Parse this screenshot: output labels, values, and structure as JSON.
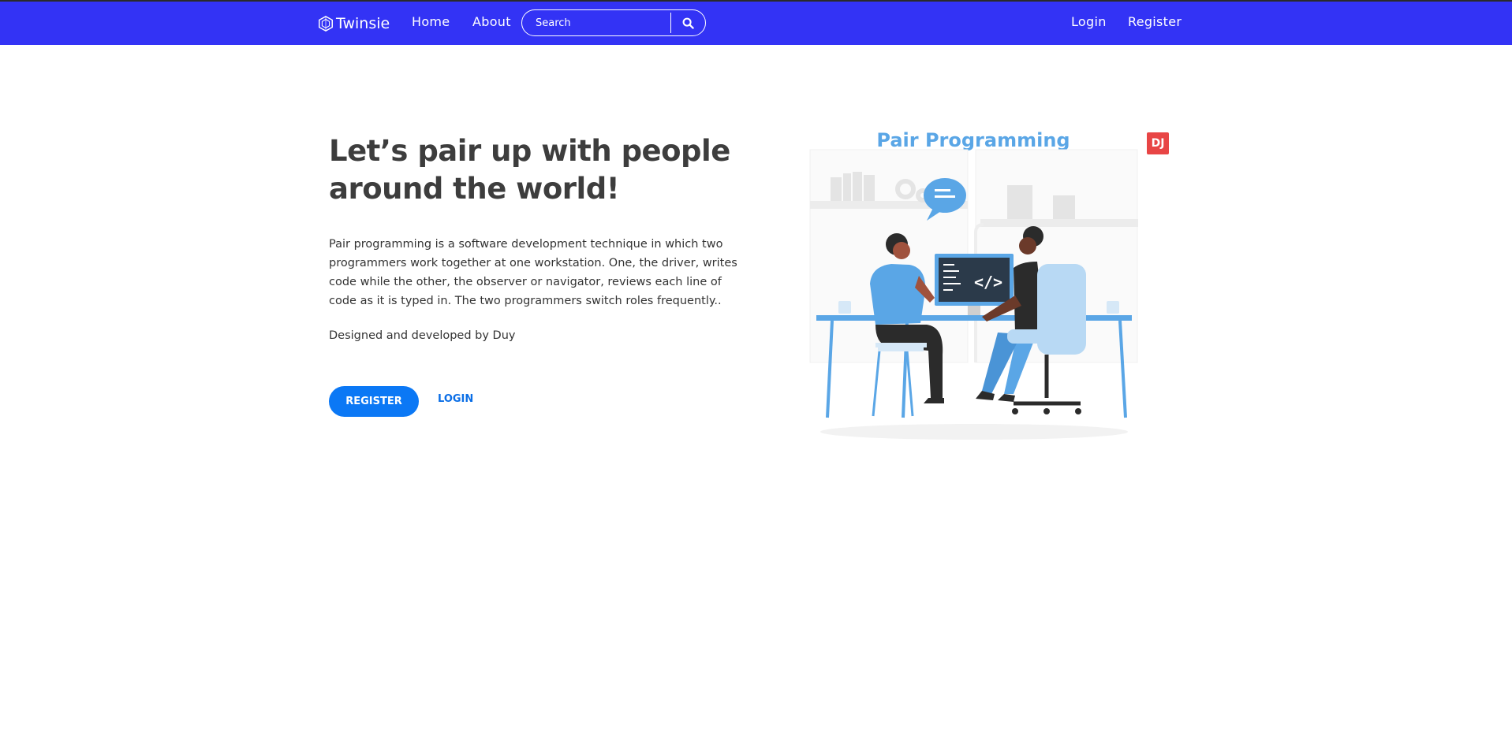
{
  "nav": {
    "brand": "Twinsie",
    "home": "Home",
    "about": "About",
    "search_placeholder": "Search",
    "login": "Login",
    "register": "Register"
  },
  "hero": {
    "title": "Let’s pair up with people around the world!",
    "description": "Pair programming is a software development technique in which two programmers work together at one workstation. One, the driver, writes code while the other, the observer or navigator, reviews each line of code as it is typed in. The two programmers switch roles frequently..",
    "credit": "Designed and developed by Duy",
    "register_button": "REGISTER",
    "login_link": "LOGIN"
  },
  "illustration": {
    "title": "Pair Programming",
    "badge": "DJ",
    "code_symbol": "</>"
  },
  "colors": {
    "navbar": "#3333f5",
    "primary_button": "#0b78f5",
    "illustration_blue": "#5aa6e6",
    "badge_red": "#e84545"
  }
}
